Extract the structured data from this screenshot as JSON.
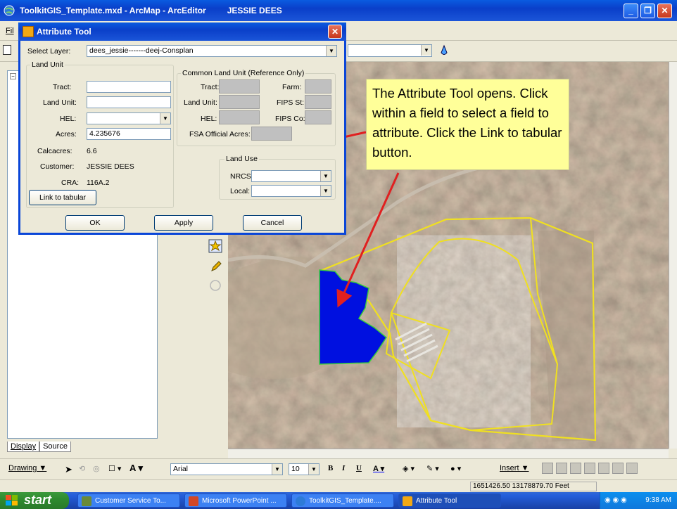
{
  "window": {
    "title": "ToolkitGIS_Template.mxd - ArcMap - ArcEditor",
    "user": "JESSIE DEES",
    "min_label": "_",
    "max_label": "❐",
    "close_label": "✕"
  },
  "menubar": {
    "first_item": "Fil"
  },
  "toc_tabs": {
    "display": "Display",
    "source": "Source"
  },
  "dialog": {
    "title": "Attribute Tool",
    "select_layer_label": "Select Layer:",
    "select_layer_value": "dees_jessie-------deej-Consplan",
    "land_unit_group": "Land Unit",
    "tract_label": "Tract:",
    "tract_value": "",
    "land_unit_label": "Land Unit:",
    "land_unit_value": "",
    "hel_label": "HEL:",
    "hel_value": "",
    "acres_label": "Acres:",
    "acres_value": "4.235676",
    "calcacres_label": "Calcacres:",
    "calcacres_value": "6.6",
    "customer_label": "Customer:",
    "customer_value": "JESSIE DEES",
    "cra_label": "CRA:",
    "cra_value": "116A.2",
    "link_button": "Link to tabular",
    "clu_group": "Common Land Unit (Reference Only)",
    "clu_tract_label": "Tract:",
    "clu_farm_label": "Farm:",
    "clu_land_unit_label": "Land Unit:",
    "clu_fips_st_label": "FIPS St:",
    "clu_hel_label": "HEL:",
    "clu_fips_co_label": "FIPS Co:",
    "clu_fsa_label": "FSA Official Acres:",
    "land_use_group": "Land Use",
    "nrcs_label": "NRCS:",
    "nrcs_value": "",
    "local_label": "Local:",
    "local_value": "",
    "ok_button": "OK",
    "apply_button": "Apply",
    "cancel_button": "Cancel"
  },
  "callout": {
    "text": "The Attribute Tool opens. Click within a field to select a field to attribute. Click the Link to tabular button."
  },
  "drawbar": {
    "drawing": "Drawing ▼",
    "font": "Arial",
    "font_size": "10",
    "bold": "B",
    "italic": "I",
    "underline": "U",
    "insert": "Insert ▼"
  },
  "statusbar": {
    "coordinates": "1651426.50  13178879.70 Feet"
  },
  "taskbar": {
    "start": "start",
    "tasks": [
      "Customer Service To...",
      "Microsoft PowerPoint ...",
      "ToolkitGIS_Template....",
      "Attribute Tool"
    ],
    "clock": "9:38 AM"
  },
  "colors": {
    "selected_polygon": "#0010e0",
    "field_outline": "#f0e020",
    "callout_bg": "#ffff99",
    "arrow": "#e02020"
  }
}
